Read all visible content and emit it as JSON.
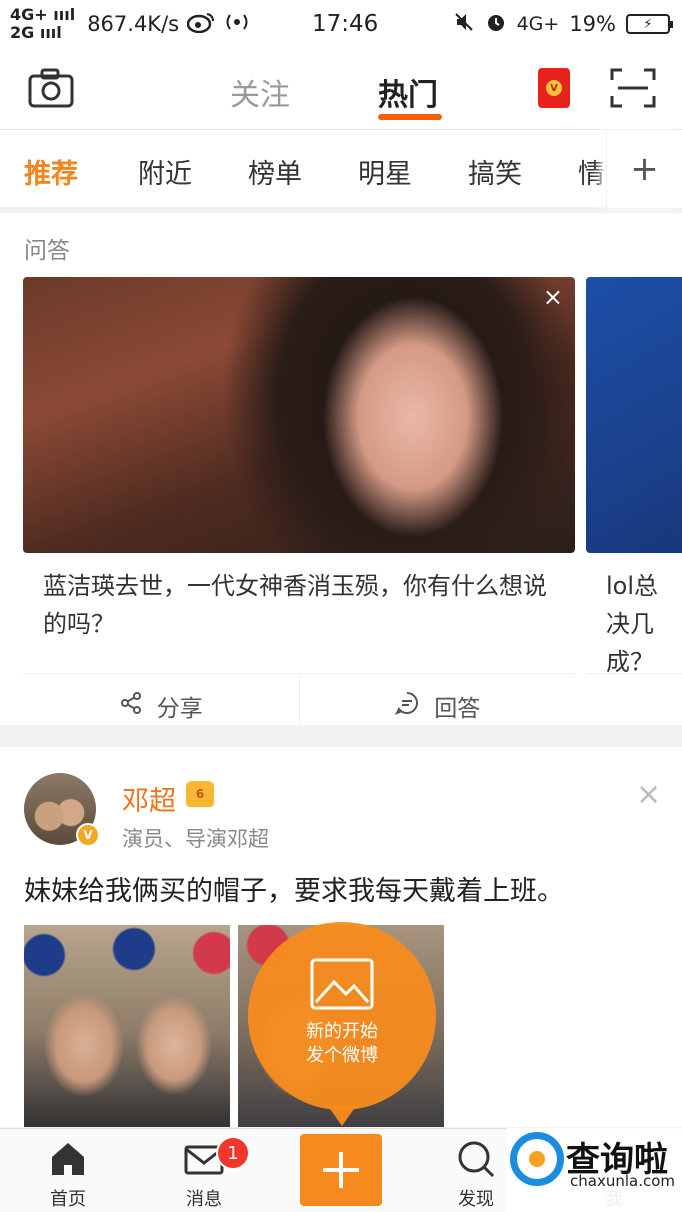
{
  "status_bar": {
    "net_top": "4G+ ıııl",
    "net_bottom": "2G ıııl",
    "speed": "867.4K/s",
    "time": "17:46",
    "network_right": "4G+",
    "battery": "19%"
  },
  "top_nav": {
    "tab_follow": "关注",
    "tab_hot": "热门",
    "redpacket_coin": "V"
  },
  "categories": {
    "items": [
      "推荐",
      "附近",
      "榜单",
      "明星",
      "搞笑",
      "情"
    ],
    "active": "推荐",
    "plus": "+"
  },
  "qa": {
    "section_title": "问答",
    "cards": [
      {
        "text": "蓝洁瑛去世，一代女神香消玉殒，你有什么想说的吗？"
      },
      {
        "text": "lol总决几成？"
      }
    ],
    "close": "×",
    "share_label": "分享",
    "answer_label": "回答"
  },
  "post": {
    "author": "邓超",
    "crown_level": "6",
    "verified": "V",
    "description": "演员、导演邓超",
    "close": "×",
    "text": "妹妹给我俩买的帽子，要求我每天戴着上班。"
  },
  "fab": {
    "line1": "新的开始",
    "line2": "发个微博"
  },
  "tabbar": {
    "home": "首页",
    "messages": "消息",
    "messages_badge": "1",
    "discover": "发现",
    "me": "我"
  },
  "watermark": {
    "title": "查询啦",
    "url": "chaxunla.com"
  },
  "colors": {
    "accent": "#f5861f",
    "hot_underline": "#f35f0f",
    "fab": "#f78a1e",
    "badge": "#f2362c"
  }
}
